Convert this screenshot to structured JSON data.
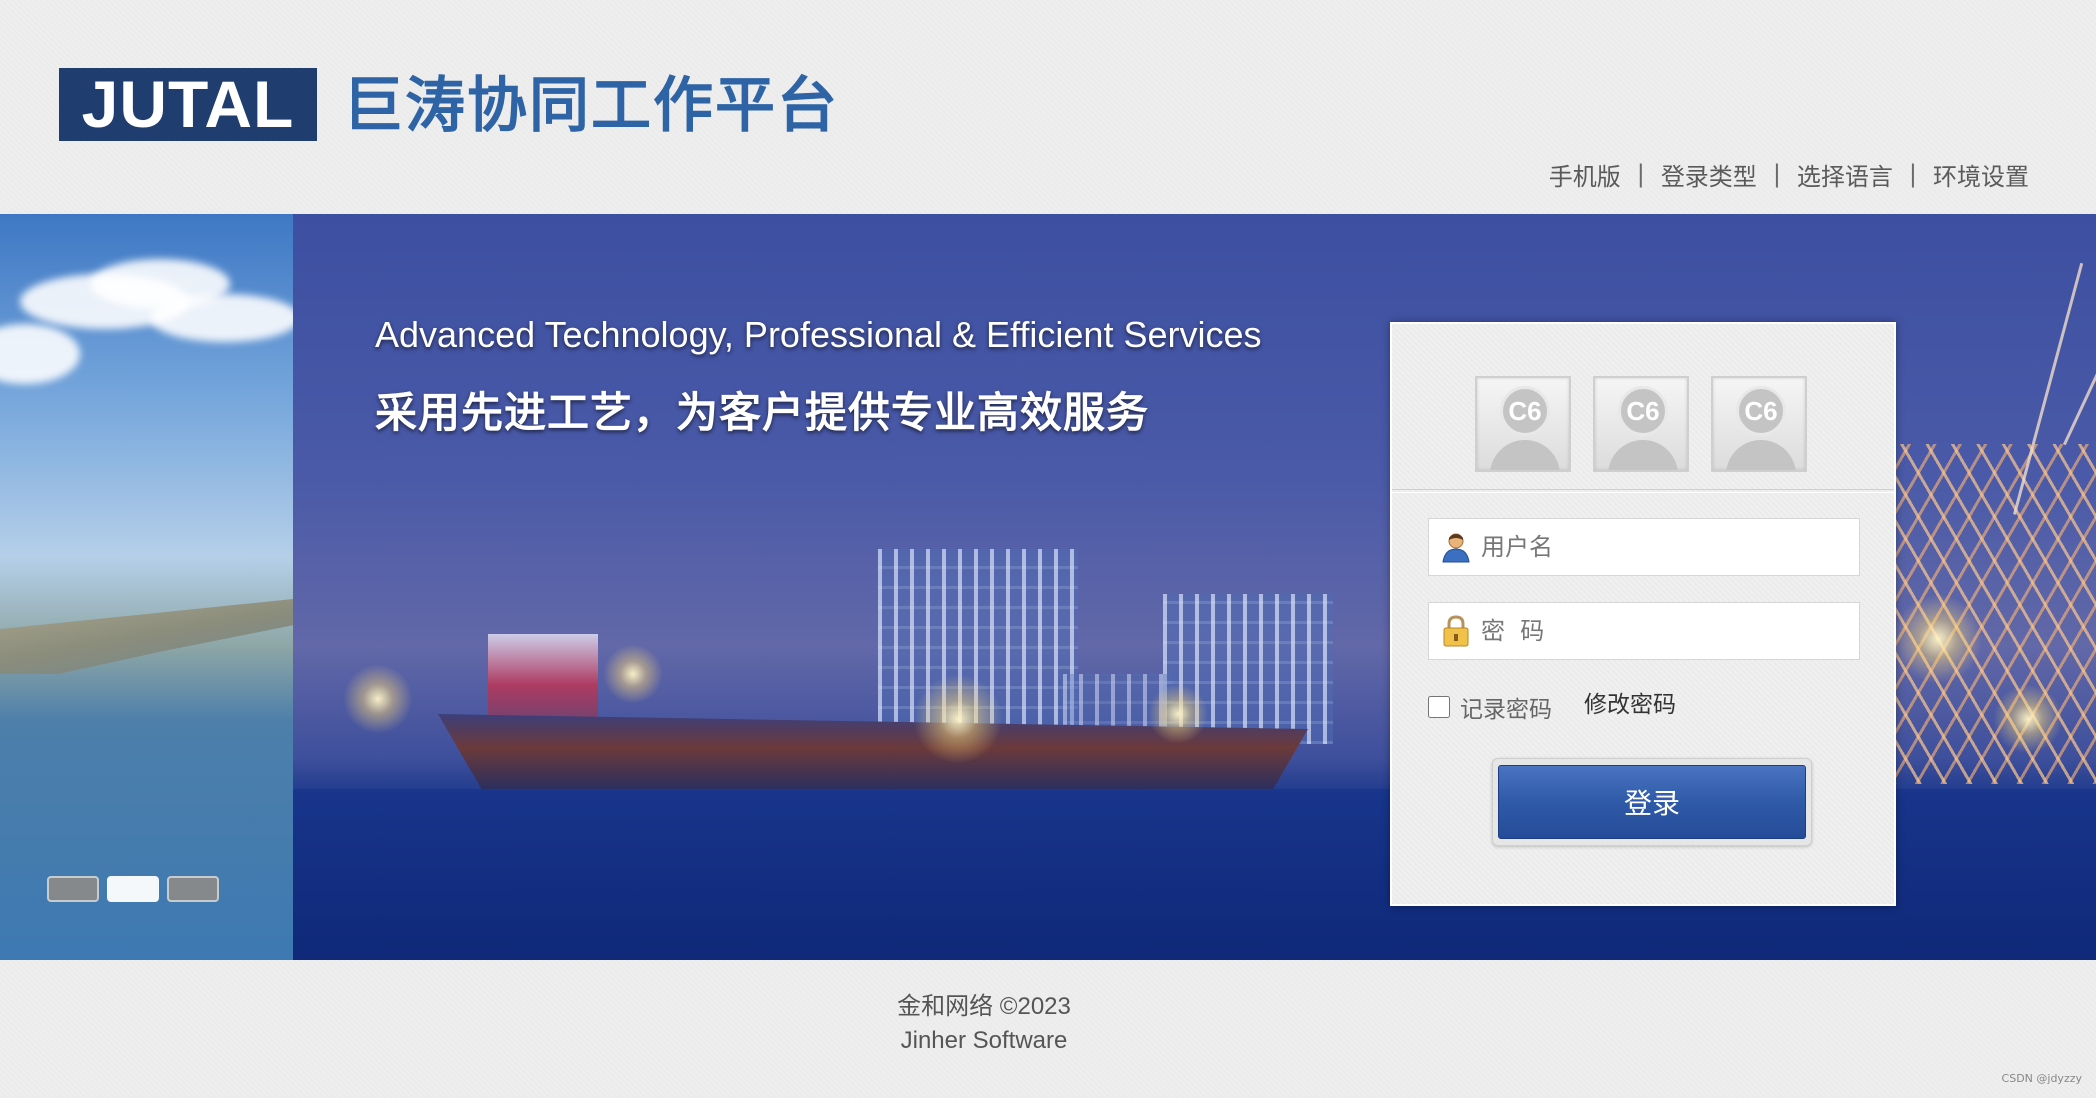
{
  "header": {
    "logo_text": "JUTAL",
    "site_title": "巨涛协同工作平台",
    "nav": [
      {
        "label": "手机版"
      },
      {
        "label": "登录类型"
      },
      {
        "label": "选择语言"
      },
      {
        "label": "环境设置"
      }
    ],
    "nav_separator": "|"
  },
  "banner": {
    "slogan_en": "Advanced Technology, Professional & Efficient Services",
    "slogan_cn": "采用先进工艺，为客户提供专业高效服务",
    "slider": {
      "count": 3,
      "active_index": 1
    }
  },
  "login": {
    "avatar_label": "C6",
    "username": {
      "placeholder": "用户名",
      "icon": "user-icon"
    },
    "password": {
      "placeholder": "密  码",
      "icon": "lock-icon"
    },
    "remember_label": "记录密码",
    "change_password_label": "修改密码",
    "submit_label": "登录"
  },
  "footer": {
    "copyright": "金和网络 ©2023",
    "company": "Jinher Software"
  },
  "watermark": "CSDN @jdyzzy",
  "colors": {
    "brand_blue": "#1f3d6e",
    "title_blue": "#2e64a6",
    "button_blue": "#2f5aa8"
  }
}
